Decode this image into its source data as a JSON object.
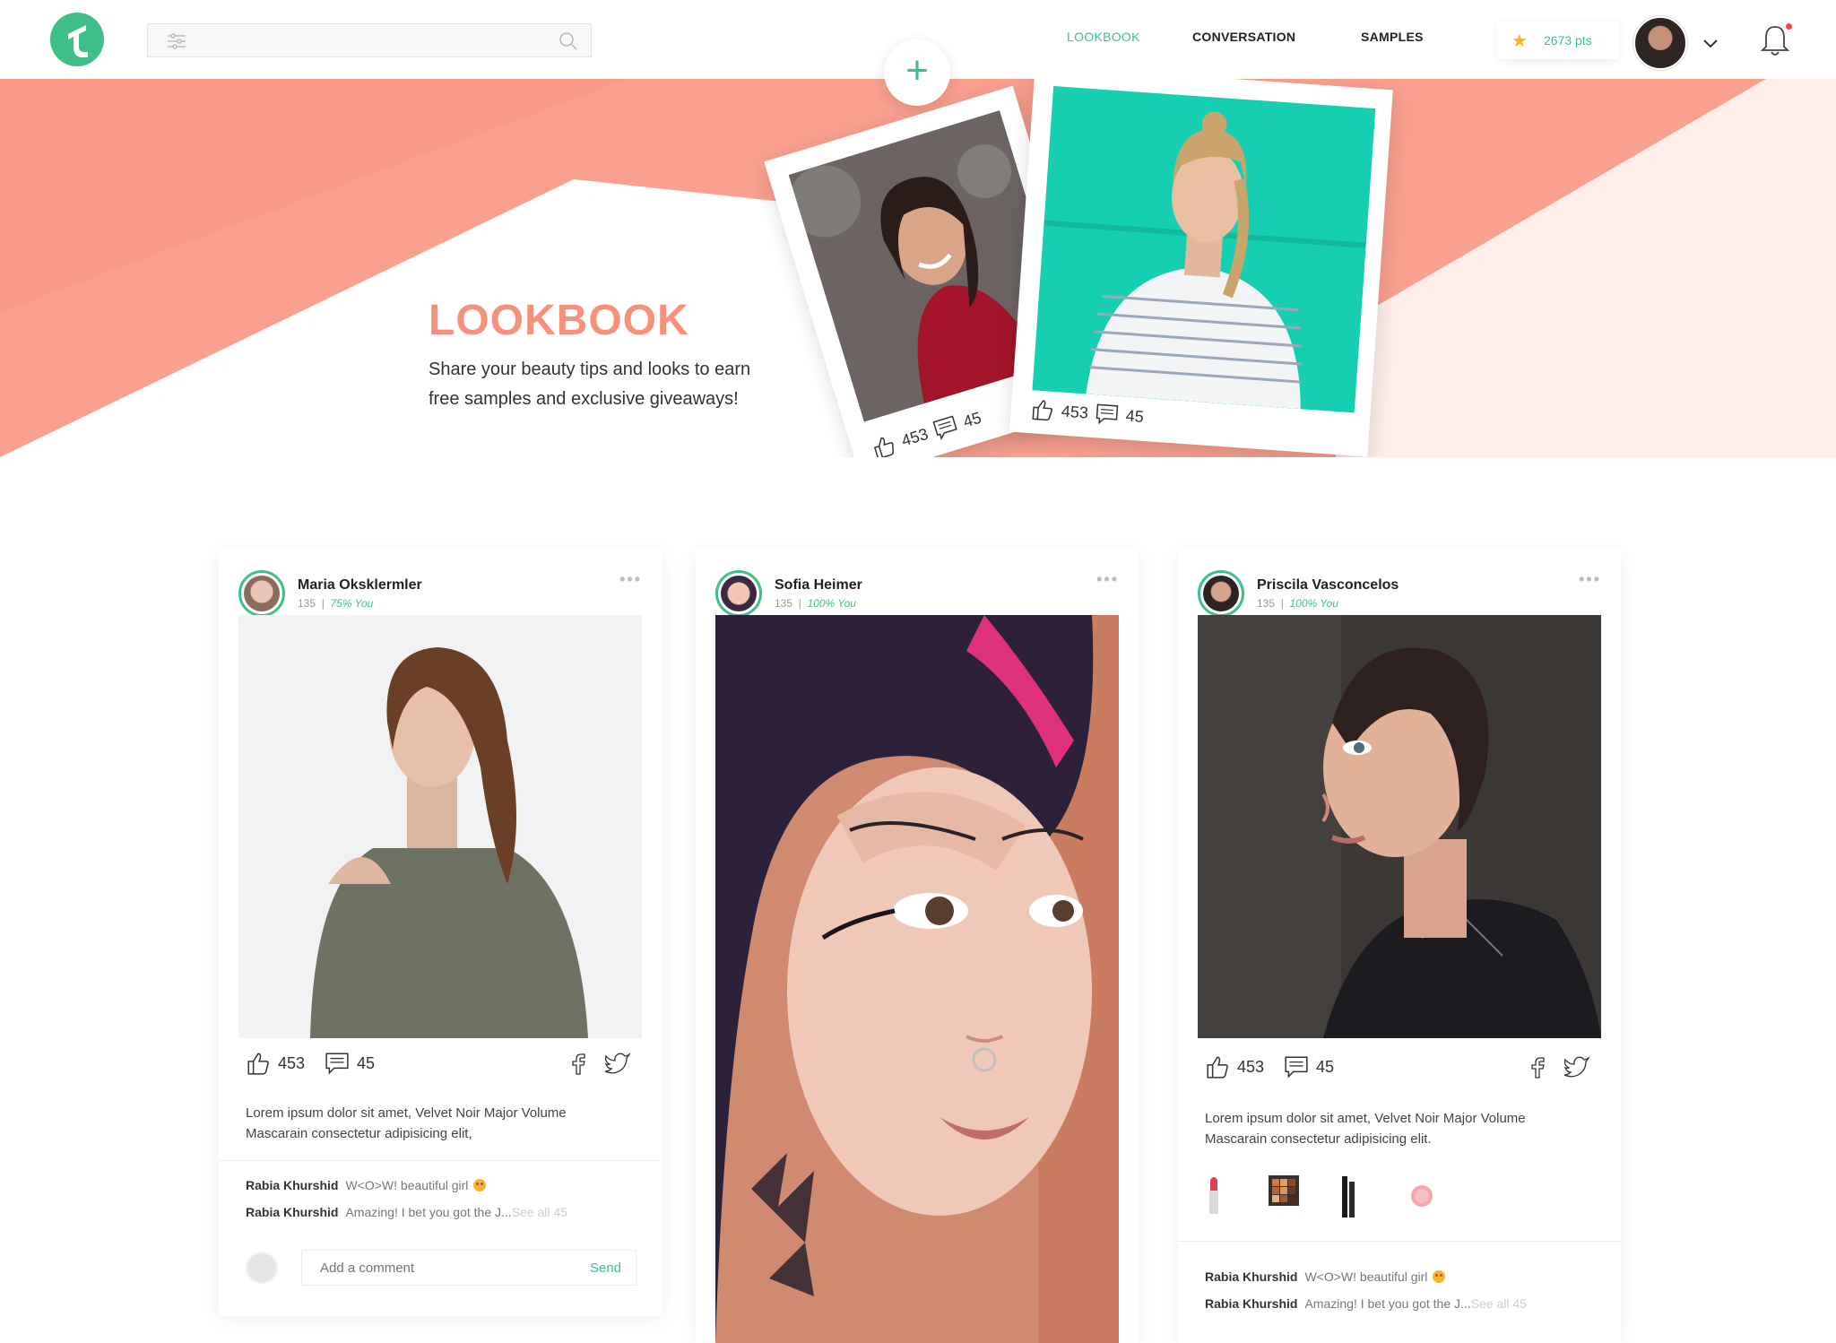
{
  "header": {
    "search_placeholder": "",
    "nav": [
      "LOOKBOOK",
      "CONVERSATION",
      "SAMPLES"
    ],
    "active_nav": "LOOKBOOK",
    "points": "2673 pts"
  },
  "hero": {
    "title": "LOOKBOOK",
    "subtitle_line1": "Share your beauty tips and looks to earn",
    "subtitle_line2": "free samples and exclusive giveaways!",
    "polaroids": [
      {
        "likes": "453",
        "comments": "45"
      },
      {
        "likes": "453",
        "comments": "45"
      }
    ]
  },
  "cards": [
    {
      "name": "Maria Oksklermler",
      "count": "135",
      "match": "75% You",
      "likes": "453",
      "comments": "45",
      "description": "Lorem ipsum dolor sit amet, Velvet Noir Major Volume Mascarain consectetur adipisicing elit,",
      "comment_list": [
        {
          "user": "Rabia Khurshid",
          "text": "W<O>W!  beautiful girl",
          "see_all": ""
        },
        {
          "user": "Rabia Khurshid",
          "text": "Amazing! I bet you got the J...",
          "see_all": "See all 45"
        }
      ],
      "add_comment_placeholder": "Add a comment",
      "send_label": "Send"
    },
    {
      "name": "Sofia Heimer",
      "count": "135",
      "match": "100% You"
    },
    {
      "name": "Priscila Vasconcelos",
      "count": "135",
      "match": "100% You",
      "likes": "453",
      "comments": "45",
      "description": "Lorem ipsum dolor sit amet, Velvet Noir Major Volume Mascarain consectetur adipisicing elit.",
      "comment_list": [
        {
          "user": "Rabia Khurshid",
          "text": "W<O>W!  beautiful girl",
          "see_all": ""
        },
        {
          "user": "Rabia Khurshid",
          "text": "Amazing! I bet you got the J...",
          "see_all": "See all 45"
        }
      ]
    }
  ],
  "colors": {
    "accent": "#3fbf8a",
    "coral": "#f9a08f",
    "title_coral": "#f6917e",
    "star": "#f6b618"
  }
}
